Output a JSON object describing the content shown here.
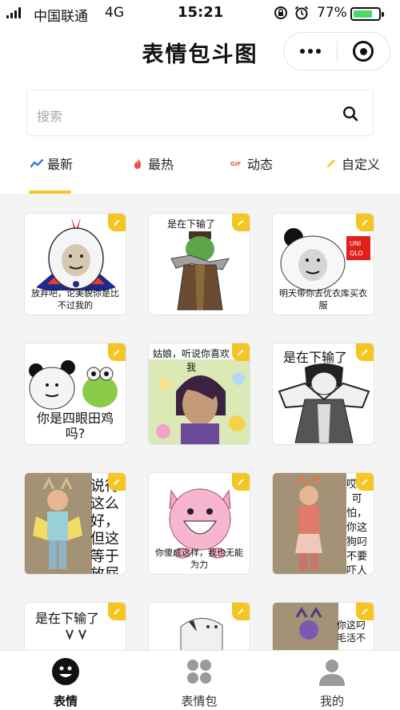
{
  "status_bar": {
    "carrier": "中国联通",
    "network": "4G",
    "time": "15:21",
    "battery_percent": "77%",
    "battery_level": 0.77
  },
  "header": {
    "title": "表情包斗图"
  },
  "search": {
    "placeholder": "搜索"
  },
  "tabs": [
    {
      "label": "最新",
      "icon": "trend-icon",
      "active": true
    },
    {
      "label": "最热",
      "icon": "flame-icon",
      "active": false
    },
    {
      "label": "动态",
      "icon": "gif-icon",
      "active": false
    },
    {
      "label": "自定义",
      "icon": "pencil-icon",
      "active": false
    }
  ],
  "memes": [
    {
      "caption": "放弃吧，论美貌你是比不过我的"
    },
    {
      "caption": "是在下输了"
    },
    {
      "caption": "明天带你去优衣库买衣服",
      "brand": "UNI QLO"
    },
    {
      "caption": "你是四眼田鸡吗?"
    },
    {
      "caption": "姑娘，听说你喜欢我"
    },
    {
      "caption": "是在下输了"
    },
    {
      "caption": "说得这么好，但这等于放屁"
    },
    {
      "caption": "你傻成这样，我也无能为力"
    },
    {
      "caption": "哎好可怕，你这狗叼不要吓人家"
    },
    {
      "caption": "是在下输了"
    },
    {
      "caption": ""
    },
    {
      "caption": "你这叼毛活不"
    }
  ],
  "colors": {
    "accent": "#f5c623",
    "grid_background": "#f4f4f4"
  },
  "bottom_nav": [
    {
      "label": "表情",
      "icon": "smiley-icon",
      "active": true
    },
    {
      "label": "表情包",
      "icon": "grid-dots-icon",
      "active": false
    },
    {
      "label": "我的",
      "icon": "user-icon",
      "active": false
    }
  ]
}
